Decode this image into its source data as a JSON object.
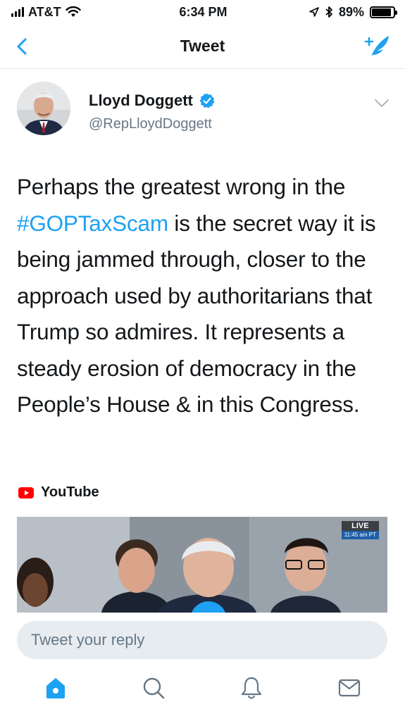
{
  "status_bar": {
    "carrier": "AT&T",
    "time": "6:34 PM",
    "battery_percent": "89%",
    "battery_level": 0.89,
    "icons": [
      "signal-icon",
      "wifi-icon",
      "location-icon",
      "bluetooth-icon",
      "battery-icon"
    ]
  },
  "nav": {
    "title": "Tweet",
    "back_icon": "chevron-left-icon",
    "compose_icon": "compose-tweet-icon"
  },
  "tweet": {
    "author_name": "Lloyd Doggett",
    "author_handle": "@RepLloydDoggett",
    "verified": true,
    "text_before": "Perhaps the greatest wrong in the ",
    "hashtag": "#GOPTaxScam",
    "text_after": " is the secret way it is being jammed through, closer to the approach used by authoritarians that Trump so admires. It represents a steady erosion of democracy in the People’s House & in this Congress."
  },
  "card": {
    "source": "YouTube",
    "live_label": "LIVE",
    "live_time": "11:45 am PT"
  },
  "reply": {
    "placeholder": "Tweet your reply"
  },
  "tab_bar": {
    "tabs": [
      "home-icon",
      "search-icon",
      "notifications-icon",
      "messages-icon"
    ],
    "active": "home-icon"
  },
  "colors": {
    "accent": "#1da1f2",
    "text": "#14171a",
    "secondary": "#657786",
    "reply_bg": "#e6ecf0",
    "youtube_red": "#ff0000"
  }
}
